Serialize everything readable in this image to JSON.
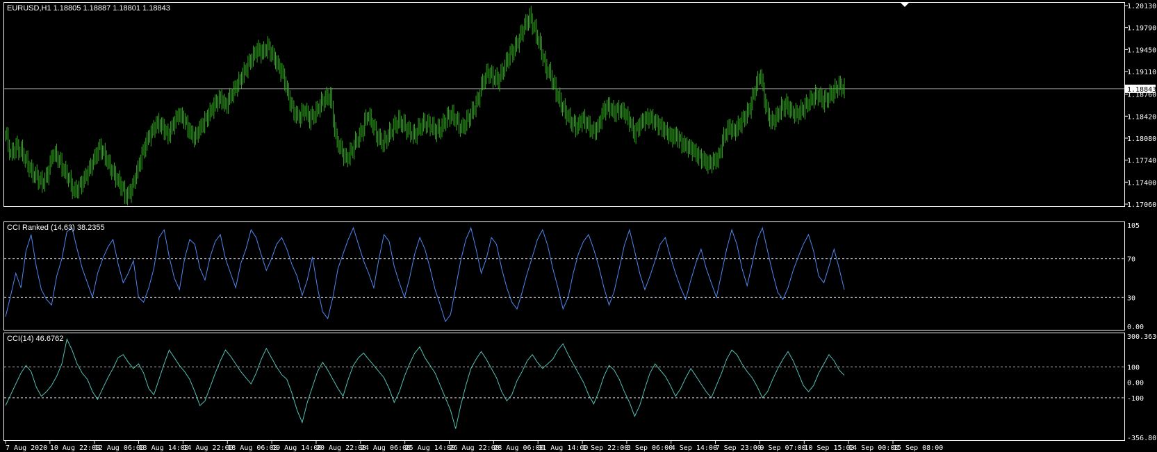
{
  "window": {
    "symbol_header": "EURUSD,H1  1.18805 1.18887 1.18801 1.18843"
  },
  "colors": {
    "background": "#000000",
    "candles": "#31a81e",
    "cci_ranked": "#4f88f2",
    "cci": "#52c1b6",
    "grid": "#ffffff",
    "price_line": "#c0c0c0"
  },
  "chart_data": [
    {
      "type": "line",
      "panel": "price",
      "title": "EURUSD,H1  1.18805 1.18887 1.18801 1.18843",
      "ylim": [
        1.1706,
        1.2013
      ],
      "y_ticks": [
        "1.20130",
        "1.19790",
        "1.19450",
        "1.19110",
        "1.18760",
        "1.18420",
        "1.18080",
        "1.17740",
        "1.17400",
        "1.17060"
      ],
      "current_price": "1.18843",
      "series": [
        {
          "values": [
            1.1815,
            1.1782,
            1.1795,
            1.1788,
            1.1772,
            1.1755,
            1.1748,
            1.1738,
            1.1752,
            1.1785,
            1.1778,
            1.176,
            1.1747,
            1.1725,
            1.1732,
            1.1745,
            1.176,
            1.1778,
            1.1795,
            1.178,
            1.1762,
            1.1748,
            1.1735,
            1.1718,
            1.1728,
            1.1755,
            1.1782,
            1.1805,
            1.182,
            1.1832,
            1.1825,
            1.1812,
            1.183,
            1.1845,
            1.1838,
            1.182,
            1.1808,
            1.1822,
            1.1835,
            1.1848,
            1.1862,
            1.187,
            1.1858,
            1.1875,
            1.1888,
            1.1902,
            1.1918,
            1.1932,
            1.1945,
            1.194,
            1.195,
            1.1935,
            1.192,
            1.1905,
            1.1872,
            1.1848,
            1.184,
            1.1852,
            1.1838,
            1.1845,
            1.186,
            1.187,
            1.1872,
            1.1808,
            1.179,
            1.1775,
            1.1788,
            1.1805,
            1.1818,
            1.1845,
            1.183,
            1.181,
            1.18,
            1.1812,
            1.1825,
            1.1835,
            1.1828,
            1.1818,
            1.1812,
            1.1825,
            1.1832,
            1.1828,
            1.182,
            1.1822,
            1.1838,
            1.1845,
            1.1835,
            1.1822,
            1.1835,
            1.1848,
            1.1865,
            1.1895,
            1.191,
            1.1902,
            1.1898,
            1.1915,
            1.1935,
            1.1945,
            1.1962,
            1.1982,
            1.1995,
            1.1975,
            1.195,
            1.1918,
            1.1905,
            1.188,
            1.186,
            1.1845,
            1.1832,
            1.1825,
            1.1838,
            1.183,
            1.1818,
            1.1825,
            1.185,
            1.1858,
            1.1848,
            1.1852,
            1.1848,
            1.1835,
            1.1815,
            1.183,
            1.1838,
            1.184,
            1.1832,
            1.1826,
            1.1818,
            1.181,
            1.1812,
            1.18,
            1.1795,
            1.179,
            1.1782,
            1.1775,
            1.1768,
            1.1772,
            1.1778,
            1.181,
            1.1825,
            1.1818,
            1.183,
            1.184,
            1.1855,
            1.1885,
            1.1908,
            1.1858,
            1.1832,
            1.184,
            1.1855,
            1.186,
            1.1848,
            1.1845,
            1.1852,
            1.1862,
            1.187,
            1.1876,
            1.1865,
            1.1872,
            1.188,
            1.189,
            1.1884
          ]
        }
      ]
    },
    {
      "type": "line",
      "panel": "cci-ranked",
      "title": "CCI Ranked (14,63) 38.2355",
      "ylim": [
        0,
        105
      ],
      "y_ticks": [
        "105",
        "70",
        "30",
        "0.00"
      ],
      "levels": [
        70,
        30
      ],
      "series": [
        {
          "values": [
            10,
            32,
            55,
            40,
            78,
            95,
            62,
            38,
            28,
            22,
            52,
            70,
            98,
            102,
            80,
            60,
            45,
            30,
            55,
            70,
            82,
            90,
            65,
            45,
            55,
            68,
            30,
            25,
            40,
            60,
            92,
            100,
            72,
            50,
            38,
            70,
            90,
            85,
            60,
            48,
            72,
            88,
            95,
            70,
            55,
            40,
            65,
            80,
            100,
            92,
            74,
            58,
            70,
            85,
            92,
            80,
            64,
            52,
            32,
            48,
            72,
            40,
            15,
            8,
            30,
            60,
            75,
            90,
            102,
            85,
            68,
            55,
            40,
            70,
            95,
            88,
            62,
            45,
            30,
            50,
            75,
            92,
            80,
            60,
            38,
            22,
            5,
            12,
            40,
            68,
            90,
            102,
            80,
            55,
            70,
            92,
            85,
            60,
            40,
            25,
            18,
            35,
            55,
            72,
            90,
            100,
            84,
            60,
            40,
            18,
            30,
            55,
            75,
            88,
            95,
            80,
            62,
            40,
            22,
            36,
            60,
            84,
            100,
            78,
            55,
            38,
            52,
            68,
            85,
            92,
            72,
            55,
            40,
            28,
            48,
            66,
            80,
            60,
            45,
            30,
            55,
            80,
            100,
            85,
            60,
            42,
            65,
            90,
            102,
            78,
            55,
            35,
            28,
            40,
            58,
            72,
            85,
            95,
            78,
            52,
            45,
            62,
            80,
            60,
            38
          ]
        }
      ]
    },
    {
      "type": "line",
      "panel": "cci",
      "title": "CCI(14) 46.6762",
      "ylim": [
        -356.8078,
        300.3636
      ],
      "y_ticks": [
        "300.3636",
        "100",
        "0.00",
        "-100",
        "-356.8078"
      ],
      "levels": [
        100,
        -100
      ],
      "series": [
        {
          "values": [
            -150,
            -80,
            -10,
            60,
            110,
            70,
            -30,
            -90,
            -60,
            -20,
            40,
            120,
            280,
            210,
            120,
            60,
            20,
            -60,
            -110,
            -40,
            30,
            90,
            160,
            180,
            130,
            90,
            120,
            60,
            -40,
            -80,
            20,
            120,
            210,
            160,
            110,
            70,
            20,
            -60,
            -150,
            -120,
            -30,
            60,
            140,
            210,
            170,
            120,
            70,
            30,
            -10,
            60,
            150,
            220,
            160,
            100,
            50,
            20,
            -70,
            -180,
            -260,
            -130,
            -30,
            70,
            130,
            80,
            20,
            -40,
            -90,
            20,
            110,
            160,
            190,
            150,
            110,
            70,
            30,
            -40,
            -130,
            -60,
            40,
            120,
            190,
            230,
            160,
            110,
            60,
            -20,
            -100,
            -180,
            -300,
            -150,
            -20,
            90,
            150,
            200,
            150,
            90,
            30,
            -60,
            -120,
            -80,
            10,
            70,
            140,
            180,
            130,
            90,
            120,
            150,
            210,
            250,
            180,
            120,
            60,
            0,
            -80,
            -140,
            -60,
            40,
            110,
            80,
            20,
            -60,
            -130,
            -220,
            -150,
            -40,
            60,
            120,
            80,
            40,
            -20,
            -90,
            -40,
            30,
            90,
            40,
            -10,
            -60,
            -100,
            -20,
            60,
            150,
            210,
            180,
            120,
            70,
            30,
            -30,
            -100,
            -60,
            20,
            90,
            150,
            200,
            140,
            60,
            -20,
            -60,
            -20,
            60,
            120,
            180,
            140,
            80,
            46
          ]
        }
      ]
    },
    {
      "type": "table",
      "panel": "time-axis",
      "x_ticks": [
        "7 Aug 2020",
        "10 Aug 22:00",
        "12 Aug 06:00",
        "13 Aug 14:00",
        "14 Aug 22:00",
        "18 Aug 06:00",
        "19 Aug 14:00",
        "20 Aug 22:00",
        "24 Aug 06:00",
        "25 Aug 14:00",
        "26 Aug 22:00",
        "28 Aug 06:00",
        "31 Aug 14:00",
        "1 Sep 22:00",
        "3 Sep 06:00",
        "4 Sep 14:00",
        "7 Sep 23:00",
        "9 Sep 07:00",
        "10 Sep 15:00",
        "14 Sep 00:00",
        "15 Sep 08:00"
      ]
    }
  ]
}
